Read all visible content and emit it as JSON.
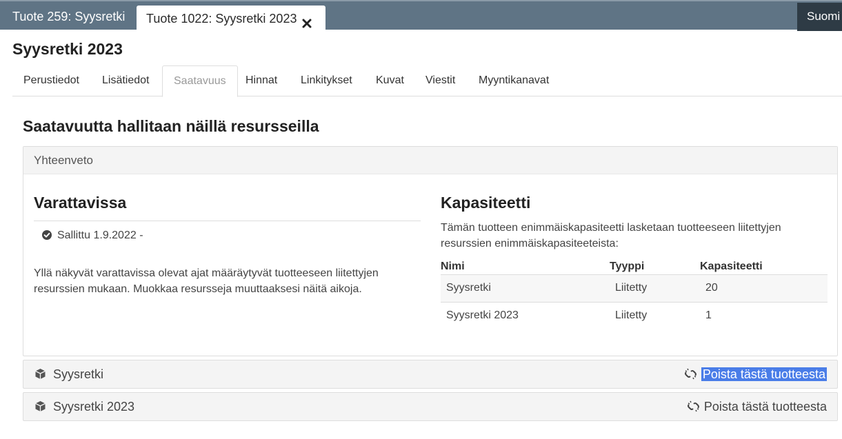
{
  "tabs": {
    "inactive": "Tuote 259: Syysretki",
    "active": "Tuote 1022: Syysretki 2023",
    "language": "Suomi"
  },
  "page_title": "Syysretki 2023",
  "subtabs": [
    "Perustiedot",
    "Lisätiedot",
    "Saatavuus",
    "Hinnat",
    "Linkitykset",
    "Kuvat",
    "Viestit",
    "Myyntikanavat"
  ],
  "active_subtab": "Saatavuus",
  "section_title": "Saatavuutta hallitaan näillä resursseilla",
  "summary": {
    "header": "Yhteenveto",
    "bookable": {
      "title": "Varattavissa",
      "allowed": "Sallittu 1.9.2022 -",
      "description": "Yllä näkyvät varattavissa olevat ajat määräytyvät tuotteeseen liitettyjen resurssien mukaan. Muokkaa resursseja muuttaaksesi näitä aikoja."
    },
    "capacity": {
      "title": "Kapasiteetti",
      "description": "Tämän tuotteen enimmäiskapasiteetti lasketaan tuotteeseen liitettyjen resurssien enimmäiskapasiteeteista:",
      "columns": [
        "Nimi",
        "Tyyppi",
        "Kapasiteetti"
      ],
      "rows": [
        [
          "Syysretki",
          "Liitetty",
          "20"
        ],
        [
          "Syysretki 2023",
          "Liitetty",
          "1"
        ]
      ]
    }
  },
  "resources": [
    {
      "name": "Syysretki",
      "action": "Poista tästä tuotteesta"
    },
    {
      "name": "Syysretki 2023",
      "action": "Poista tästä tuotteesta"
    }
  ],
  "colors": {
    "topbar": "#5f7485",
    "language_bg": "#2e3b45",
    "selection": "#4a7de8"
  }
}
